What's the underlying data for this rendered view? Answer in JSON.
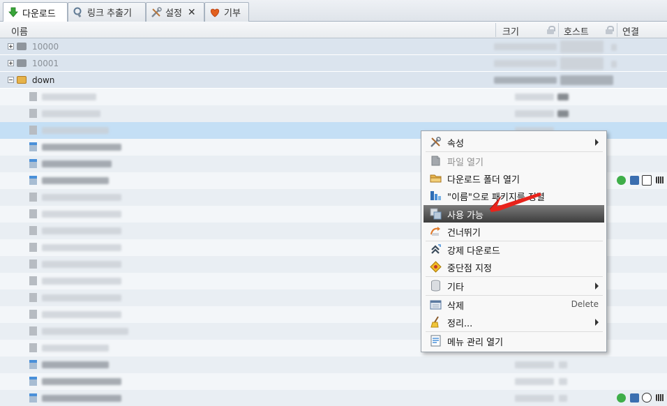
{
  "tabs": [
    {
      "label": "다운로드",
      "icon": "download-arrow-icon",
      "active": true
    },
    {
      "label": "링크 추출기",
      "icon": "link-grabber-icon",
      "active": false
    },
    {
      "label": "설정",
      "icon": "tools-icon",
      "active": false
    },
    {
      "label": "기부",
      "icon": "heart-icon",
      "active": false
    }
  ],
  "tab_close": "✕",
  "columns": {
    "name": "이름",
    "size": "크기",
    "host": "호스트",
    "connection": "연결"
  },
  "packages": [
    {
      "name": "10000",
      "expanded": false
    },
    {
      "name": "10001",
      "expanded": false
    },
    {
      "name": "down",
      "expanded": true
    }
  ],
  "context_menu": {
    "items": [
      {
        "label": "속성",
        "icon": "wrench-icon",
        "submenu": true
      },
      {
        "label": "파일 열기",
        "icon": "open-file-icon",
        "disabled": true
      },
      {
        "label": "다운로드 폴더 열기",
        "icon": "folder-icon"
      },
      {
        "label": "\"이름\"으로 패키지를 정렬",
        "icon": "sort-icon"
      },
      {
        "label": "사용 가능",
        "icon": "enable-icon",
        "highlighted": true
      },
      {
        "label": "건너뛰기",
        "icon": "skip-icon"
      },
      {
        "label": "강제 다운로드",
        "icon": "force-download-icon"
      },
      {
        "label": "중단점 지정",
        "icon": "stopmark-icon"
      },
      {
        "label": "기타",
        "icon": "other-icon",
        "submenu": true
      },
      {
        "label": "삭제",
        "icon": "delete-icon",
        "shortcut": "Delete"
      },
      {
        "label": "정리...",
        "icon": "broom-icon",
        "submenu": true
      },
      {
        "label": "메뉴 관리 열기",
        "icon": "menu-manager-icon"
      }
    ]
  },
  "colors": {
    "highlight": "#4a4a4a",
    "selected_row": "#c4dff5",
    "pointer": "#e8231b"
  }
}
